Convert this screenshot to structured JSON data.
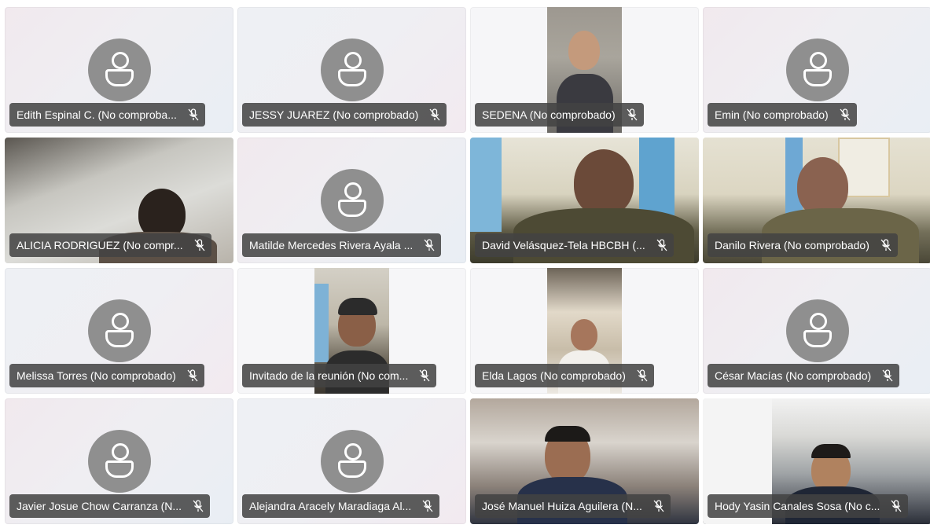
{
  "participants": [
    {
      "name": "Edith Espinal C. (No comproba...",
      "muted": true
    },
    {
      "name": "JESSY JUAREZ (No comprobado)",
      "muted": true
    },
    {
      "name": "SEDENA (No comprobado)",
      "muted": true
    },
    {
      "name": "Emin (No comprobado)",
      "muted": true
    },
    {
      "name": "ALICIA RODRIGUEZ (No compr...",
      "muted": true
    },
    {
      "name": "Matilde Mercedes Rivera Ayala ...",
      "muted": true
    },
    {
      "name": "David Velásquez-Tela HBCBH (...",
      "muted": true
    },
    {
      "name": "Danilo Rivera (No comprobado)",
      "muted": true
    },
    {
      "name": "Melissa Torres (No comprobado)",
      "muted": true
    },
    {
      "name": "Invitado de la reunión (No com...",
      "muted": true
    },
    {
      "name": "Elda Lagos (No comprobado)",
      "muted": true
    },
    {
      "name": "César Macías (No comprobado)",
      "muted": true
    },
    {
      "name": "Javier Josue Chow Carranza (N...",
      "muted": true
    },
    {
      "name": "Alejandra Aracely Maradiaga Al...",
      "muted": true
    },
    {
      "name": "José Manuel Huiza Aguilera (N...",
      "muted": true
    },
    {
      "name": "Hody Yasin Canales Sosa (No c...",
      "muted": true
    }
  ],
  "icons": {
    "avatar": "person-outline-icon",
    "mic": "microphone-off-icon"
  },
  "colors": {
    "label_bg": "#424242",
    "avatar_bg": "#8f8f8f"
  }
}
